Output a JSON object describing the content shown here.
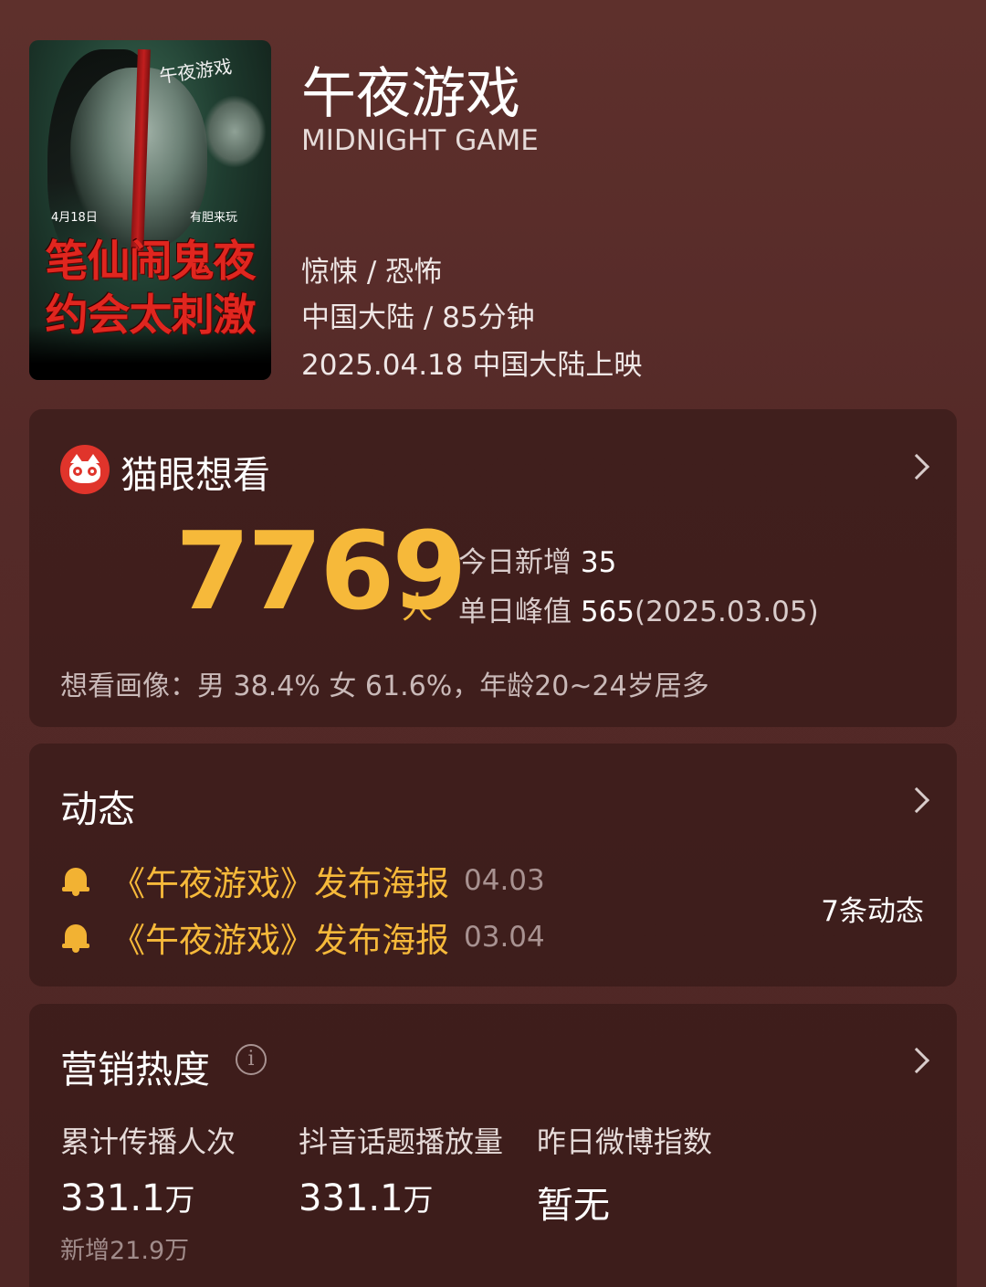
{
  "movie": {
    "title": "午夜游戏",
    "title_en": "MIDNIGHT GAME",
    "genre": "惊悚 / 恐怖",
    "region_duration": "中国大陆 / 85分钟",
    "release": "2025.04.18 中国大陆上映",
    "poster": {
      "logo_text": "午夜游戏",
      "date_text": "4月18日",
      "tag_text": "有胆来玩",
      "slogan_line1": "笔仙闹鬼夜",
      "slogan_line2": "约会太刺激"
    }
  },
  "want_card": {
    "title": "猫眼想看",
    "icon": "maoyan-cat-icon",
    "count": "7769",
    "unit": "人",
    "today_label": "今日新增",
    "today_value": "35",
    "peak_label": "单日峰值",
    "peak_value": "565",
    "peak_date": "(2025.03.05)",
    "profile": "想看画像：男 38.4%  女 61.6%，年龄20~24岁居多"
  },
  "news_card": {
    "title": "动态",
    "items": [
      {
        "title": "《午夜游戏》发布海报",
        "date": "04.03",
        "icon": "bell-icon"
      },
      {
        "title": "《午夜游戏》发布海报",
        "date": "03.04",
        "icon": "bell-icon"
      }
    ],
    "count_label": "7条动态"
  },
  "marketing_card": {
    "title": "营销热度",
    "metrics": [
      {
        "label": "累计传播人次",
        "value": "331.1",
        "unit": "万",
        "sub": "新增21.9万"
      },
      {
        "label": "抖音话题播放量",
        "value": "331.1",
        "unit": "万",
        "sub": ""
      },
      {
        "label": "昨日微博指数",
        "value": "暂无",
        "unit": "",
        "sub": ""
      }
    ]
  },
  "colors": {
    "accent": "#f6b93a",
    "background": "#552a28",
    "card": "#3a1d1b",
    "brand_red": "#e0342b"
  }
}
